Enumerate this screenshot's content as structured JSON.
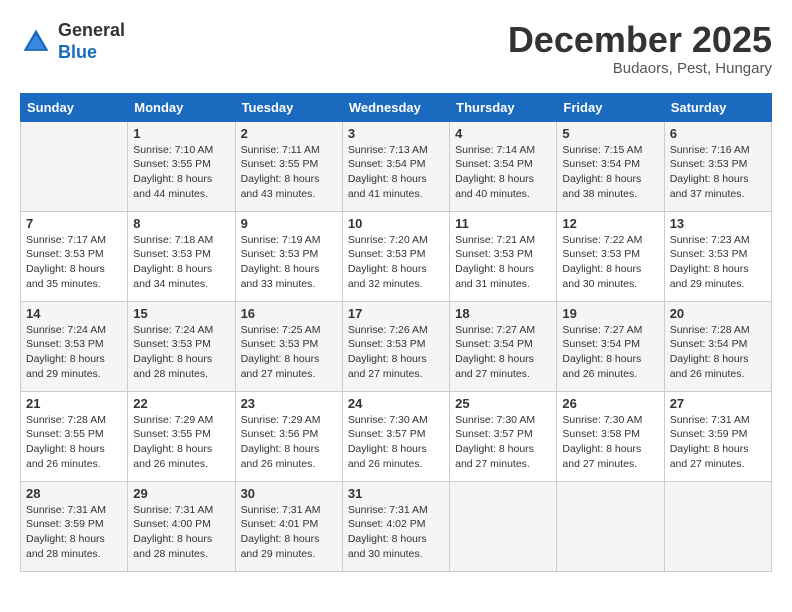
{
  "header": {
    "logo_line1": "General",
    "logo_line2": "Blue",
    "month": "December 2025",
    "location": "Budaors, Pest, Hungary"
  },
  "days_of_week": [
    "Sunday",
    "Monday",
    "Tuesday",
    "Wednesday",
    "Thursday",
    "Friday",
    "Saturday"
  ],
  "weeks": [
    [
      {
        "day": "",
        "info": ""
      },
      {
        "day": "1",
        "info": "Sunrise: 7:10 AM\nSunset: 3:55 PM\nDaylight: 8 hours\nand 44 minutes."
      },
      {
        "day": "2",
        "info": "Sunrise: 7:11 AM\nSunset: 3:55 PM\nDaylight: 8 hours\nand 43 minutes."
      },
      {
        "day": "3",
        "info": "Sunrise: 7:13 AM\nSunset: 3:54 PM\nDaylight: 8 hours\nand 41 minutes."
      },
      {
        "day": "4",
        "info": "Sunrise: 7:14 AM\nSunset: 3:54 PM\nDaylight: 8 hours\nand 40 minutes."
      },
      {
        "day": "5",
        "info": "Sunrise: 7:15 AM\nSunset: 3:54 PM\nDaylight: 8 hours\nand 38 minutes."
      },
      {
        "day": "6",
        "info": "Sunrise: 7:16 AM\nSunset: 3:53 PM\nDaylight: 8 hours\nand 37 minutes."
      }
    ],
    [
      {
        "day": "7",
        "info": "Sunrise: 7:17 AM\nSunset: 3:53 PM\nDaylight: 8 hours\nand 35 minutes."
      },
      {
        "day": "8",
        "info": "Sunrise: 7:18 AM\nSunset: 3:53 PM\nDaylight: 8 hours\nand 34 minutes."
      },
      {
        "day": "9",
        "info": "Sunrise: 7:19 AM\nSunset: 3:53 PM\nDaylight: 8 hours\nand 33 minutes."
      },
      {
        "day": "10",
        "info": "Sunrise: 7:20 AM\nSunset: 3:53 PM\nDaylight: 8 hours\nand 32 minutes."
      },
      {
        "day": "11",
        "info": "Sunrise: 7:21 AM\nSunset: 3:53 PM\nDaylight: 8 hours\nand 31 minutes."
      },
      {
        "day": "12",
        "info": "Sunrise: 7:22 AM\nSunset: 3:53 PM\nDaylight: 8 hours\nand 30 minutes."
      },
      {
        "day": "13",
        "info": "Sunrise: 7:23 AM\nSunset: 3:53 PM\nDaylight: 8 hours\nand 29 minutes."
      }
    ],
    [
      {
        "day": "14",
        "info": "Sunrise: 7:24 AM\nSunset: 3:53 PM\nDaylight: 8 hours\nand 29 minutes."
      },
      {
        "day": "15",
        "info": "Sunrise: 7:24 AM\nSunset: 3:53 PM\nDaylight: 8 hours\nand 28 minutes."
      },
      {
        "day": "16",
        "info": "Sunrise: 7:25 AM\nSunset: 3:53 PM\nDaylight: 8 hours\nand 27 minutes."
      },
      {
        "day": "17",
        "info": "Sunrise: 7:26 AM\nSunset: 3:53 PM\nDaylight: 8 hours\nand 27 minutes."
      },
      {
        "day": "18",
        "info": "Sunrise: 7:27 AM\nSunset: 3:54 PM\nDaylight: 8 hours\nand 27 minutes."
      },
      {
        "day": "19",
        "info": "Sunrise: 7:27 AM\nSunset: 3:54 PM\nDaylight: 8 hours\nand 26 minutes."
      },
      {
        "day": "20",
        "info": "Sunrise: 7:28 AM\nSunset: 3:54 PM\nDaylight: 8 hours\nand 26 minutes."
      }
    ],
    [
      {
        "day": "21",
        "info": "Sunrise: 7:28 AM\nSunset: 3:55 PM\nDaylight: 8 hours\nand 26 minutes."
      },
      {
        "day": "22",
        "info": "Sunrise: 7:29 AM\nSunset: 3:55 PM\nDaylight: 8 hours\nand 26 minutes."
      },
      {
        "day": "23",
        "info": "Sunrise: 7:29 AM\nSunset: 3:56 PM\nDaylight: 8 hours\nand 26 minutes."
      },
      {
        "day": "24",
        "info": "Sunrise: 7:30 AM\nSunset: 3:57 PM\nDaylight: 8 hours\nand 26 minutes."
      },
      {
        "day": "25",
        "info": "Sunrise: 7:30 AM\nSunset: 3:57 PM\nDaylight: 8 hours\nand 27 minutes."
      },
      {
        "day": "26",
        "info": "Sunrise: 7:30 AM\nSunset: 3:58 PM\nDaylight: 8 hours\nand 27 minutes."
      },
      {
        "day": "27",
        "info": "Sunrise: 7:31 AM\nSunset: 3:59 PM\nDaylight: 8 hours\nand 27 minutes."
      }
    ],
    [
      {
        "day": "28",
        "info": "Sunrise: 7:31 AM\nSunset: 3:59 PM\nDaylight: 8 hours\nand 28 minutes."
      },
      {
        "day": "29",
        "info": "Sunrise: 7:31 AM\nSunset: 4:00 PM\nDaylight: 8 hours\nand 28 minutes."
      },
      {
        "day": "30",
        "info": "Sunrise: 7:31 AM\nSunset: 4:01 PM\nDaylight: 8 hours\nand 29 minutes."
      },
      {
        "day": "31",
        "info": "Sunrise: 7:31 AM\nSunset: 4:02 PM\nDaylight: 8 hours\nand 30 minutes."
      },
      {
        "day": "",
        "info": ""
      },
      {
        "day": "",
        "info": ""
      },
      {
        "day": "",
        "info": ""
      }
    ]
  ]
}
